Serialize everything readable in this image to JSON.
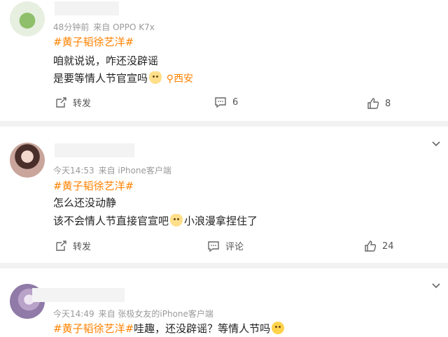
{
  "comments": [
    {
      "meta": {
        "time": "48分钟前",
        "source": "来自 OPPO K7x"
      },
      "topic": "#黄子韬徐艺洋#",
      "lines": [
        "咱就说说，咋还没辟谣",
        "是要等情人节官宣吗"
      ],
      "location": "西安",
      "actions": {
        "repost_label": "转发",
        "comment_count": "6",
        "like_count": "8"
      }
    },
    {
      "meta": {
        "time": "今天14:53",
        "source": "来自 iPhone客户端"
      },
      "topic": "#黄子韬徐艺洋#",
      "lines": [
        "怎么还没动静",
        "该不会情人节直接官宣吧"
      ],
      "tail": "小浪漫拿捏住了",
      "actions": {
        "repost_label": "转发",
        "comment_label": "评论",
        "like_count": "24"
      }
    },
    {
      "meta": {
        "time": "今天14:49",
        "source": "来自 张极女友的iPhone客户端"
      },
      "topic": "#黄子韬徐艺洋#",
      "text": "哇趣，还没辟谣？等情人节吗"
    }
  ]
}
